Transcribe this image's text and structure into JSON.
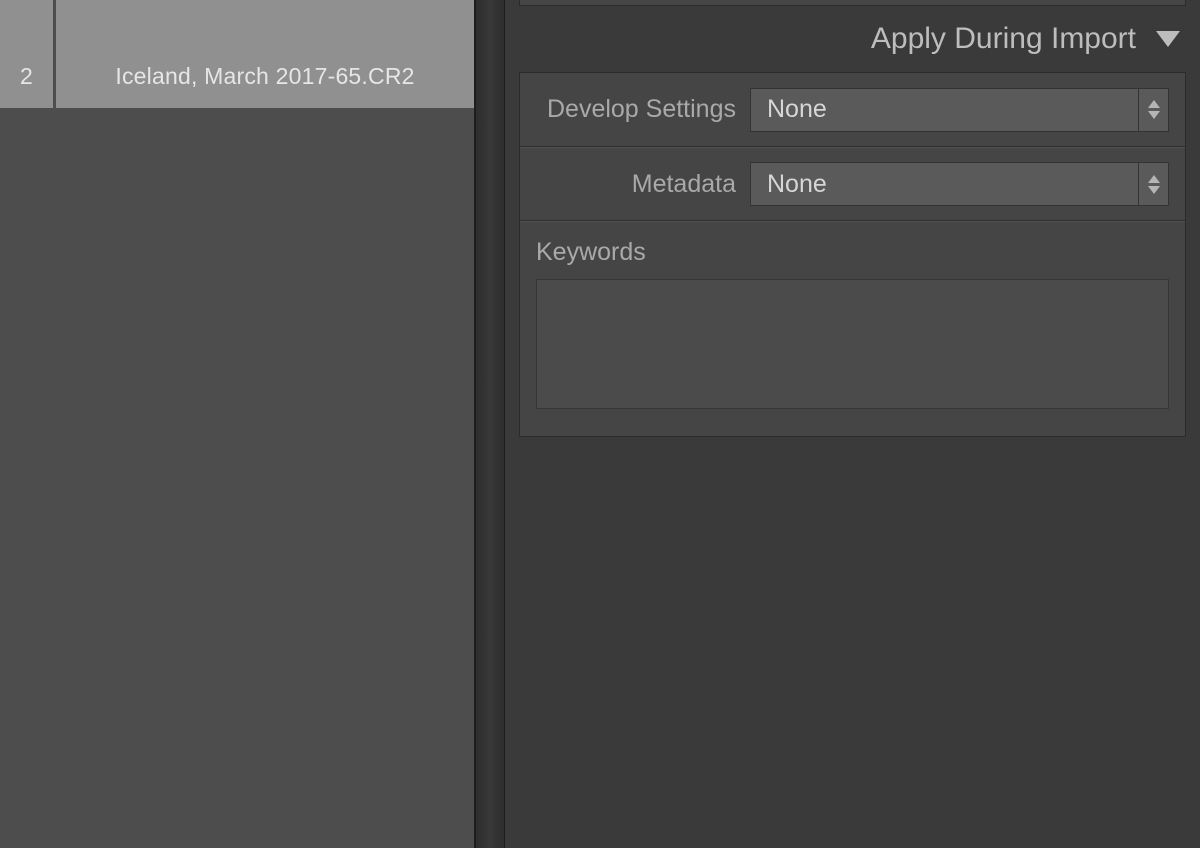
{
  "grid": {
    "thumbnails": [
      {
        "filename_suffix": "2"
      },
      {
        "filename": "Iceland, March 2017-65.CR2"
      }
    ]
  },
  "apply_during_import": {
    "title": "Apply During Import",
    "develop_settings": {
      "label": "Develop Settings",
      "value": "None"
    },
    "metadata": {
      "label": "Metadata",
      "value": "None"
    },
    "keywords": {
      "label": "Keywords",
      "value": ""
    }
  }
}
